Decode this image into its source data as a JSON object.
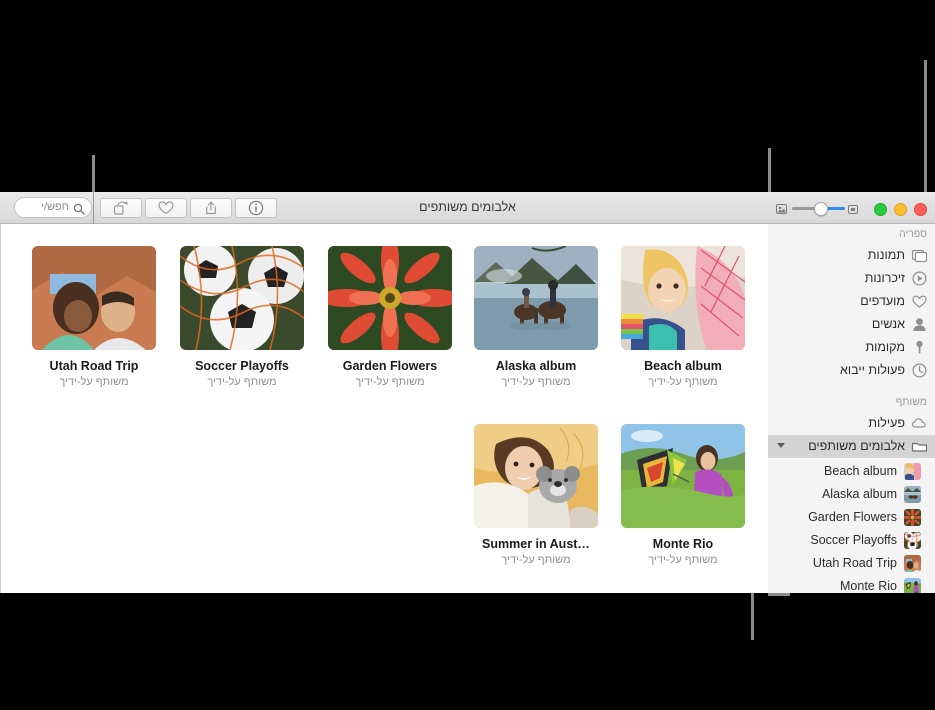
{
  "window": {
    "title": "אלבומים משותפים",
    "traffic_lights": [
      "close",
      "minimize",
      "zoom"
    ]
  },
  "toolbar": {
    "search": {
      "placeholder": "חפש/י",
      "value": "",
      "icon": "search-icon"
    },
    "buttons": [
      {
        "name": "rotate-button",
        "icon": "rotate-icon",
        "label": "סובב"
      },
      {
        "name": "favorite-button",
        "icon": "heart-icon",
        "label": "מועדף"
      },
      {
        "name": "share-button",
        "icon": "share-icon",
        "label": "שתף"
      },
      {
        "name": "info-button",
        "icon": "info-icon",
        "label": "מידע"
      }
    ],
    "zoom_slider": {
      "name": "thumbnail-size-slider",
      "min_icon": "small-thumbnail-icon",
      "max_icon": "large-thumbnail-icon",
      "value": 45
    }
  },
  "content": {
    "albums": [
      {
        "title": "Utah Road Trip",
        "subtitle": "משותף על-ידיך",
        "thumb": "utah"
      },
      {
        "title": "Soccer Playoffs",
        "subtitle": "משותף על-ידיך",
        "thumb": "soccer"
      },
      {
        "title": "Garden Flowers",
        "subtitle": "משותף על-ידיך",
        "thumb": "flower"
      },
      {
        "title": "Alaska album",
        "subtitle": "משותף על-ידיך",
        "thumb": "alaska"
      },
      {
        "title": "Beach album",
        "subtitle": "משותף על-ידיך",
        "thumb": "beach"
      },
      {
        "title": "Summer in Aust…",
        "subtitle": "משותף על-ידיך",
        "thumb": "summer"
      },
      {
        "title": "Monte Rio",
        "subtitle": "משותף על-ידיך",
        "thumb": "kite"
      }
    ]
  },
  "sidebar": {
    "library_header": "ספריה",
    "library_items": [
      {
        "label": "תמונות",
        "icon": "photos-icon"
      },
      {
        "label": "זיכרונות",
        "icon": "memories-icon"
      },
      {
        "label": "מועדפים",
        "icon": "heart-icon"
      },
      {
        "label": "אנשים",
        "icon": "person-icon"
      },
      {
        "label": "מקומות",
        "icon": "pin-icon"
      },
      {
        "label": "פעולות ייבוא",
        "icon": "clock-icon"
      }
    ],
    "shared_header": "משותף",
    "shared_items": [
      {
        "label": "פעילות",
        "icon": "cloud-icon"
      }
    ],
    "shared_albums_row": {
      "label": "אלבומים משותפים",
      "icon": "folder-icon",
      "selected": true
    },
    "shared_albums": [
      {
        "label": "Beach album",
        "thumb": "beach"
      },
      {
        "label": "Alaska album",
        "thumb": "alaska"
      },
      {
        "label": "Garden Flowers",
        "thumb": "flower"
      },
      {
        "label": "Soccer Playoffs",
        "thumb": "soccer"
      },
      {
        "label": "Utah Road Trip",
        "thumb": "utah"
      },
      {
        "label": "Monte Rio",
        "thumb": "kite"
      }
    ]
  },
  "callouts": {
    "line_color": "#8c8c8c",
    "items": [
      {
        "name": "callout-toolbar",
        "target": "toolbar-buttons"
      },
      {
        "name": "callout-zoom-slider",
        "target": "thumbnail-size-slider"
      },
      {
        "name": "callout-shared-albums",
        "target": "shared-albums-row"
      },
      {
        "name": "callout-album-list",
        "target": "shared-albums-list"
      }
    ]
  }
}
